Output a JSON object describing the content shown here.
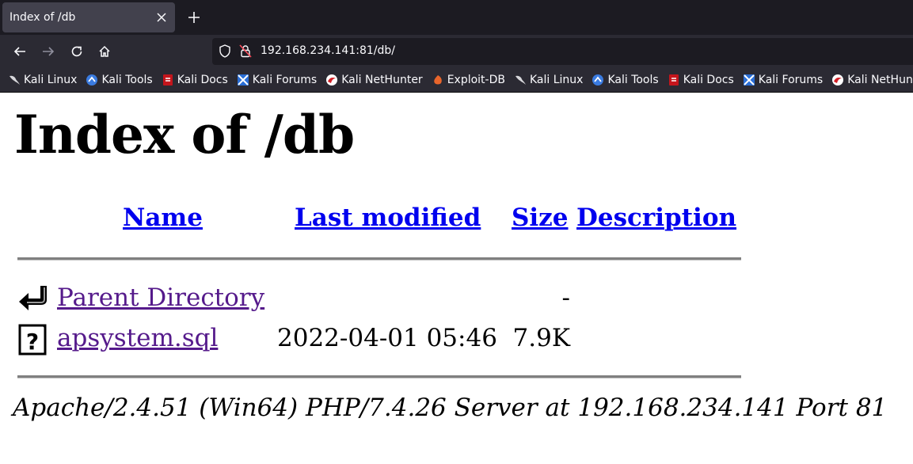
{
  "browser": {
    "tab": {
      "title": "Index of /db"
    },
    "url": "192.168.234.141:81/db/",
    "bookmarks": [
      {
        "label": "Kali Linux",
        "icon": "kali-dragon-icon"
      },
      {
        "label": "Kali Tools",
        "icon": "kali-tools-icon"
      },
      {
        "label": "Kali Docs",
        "icon": "kali-docs-icon"
      },
      {
        "label": "Kali Forums",
        "icon": "kali-forums-icon"
      },
      {
        "label": "Kali NetHunter",
        "icon": "nethunter-icon"
      },
      {
        "label": "Exploit-DB",
        "icon": "exploit-db-icon"
      },
      {
        "label": "Kali Linux",
        "icon": "kali-dragon-icon"
      },
      {
        "label": "Kali Tools",
        "icon": "kali-tools-icon"
      },
      {
        "label": "Kali Docs",
        "icon": "kali-docs-icon"
      },
      {
        "label": "Kali Forums",
        "icon": "kali-forums-icon"
      },
      {
        "label": "Kali NetHunter",
        "icon": "nethunter-icon"
      }
    ]
  },
  "page": {
    "title": "Index of /db",
    "columns": {
      "name": "Name",
      "last_modified": "Last modified",
      "size": "Size",
      "description": "Description"
    },
    "rows": [
      {
        "name": "Parent Directory",
        "last_modified": "",
        "size": "-",
        "icon": "back-arrow-icon"
      },
      {
        "name": "apsystem.sql",
        "last_modified": "2022-04-01 05:46",
        "size": "7.9K",
        "icon": "unknown-file-icon"
      }
    ],
    "address": "Apache/2.4.51 (Win64) PHP/7.4.26 Server at 192.168.234.141 Port 81"
  }
}
